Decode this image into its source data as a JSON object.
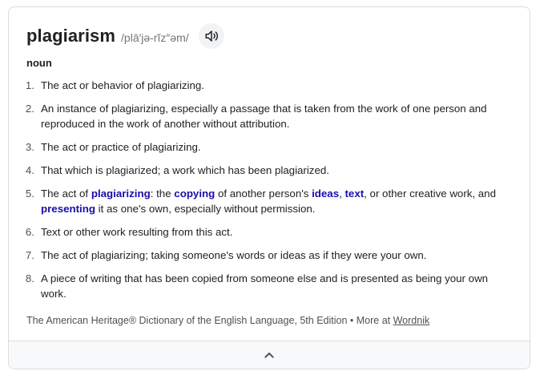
{
  "entry": {
    "word": "plagiarism",
    "pronunciation": "/plā′jə-rĭz″əm/",
    "audio_icon": "speaker-icon",
    "part_of_speech": "noun"
  },
  "definitions": [
    {
      "num": "1.",
      "text": "The act or behavior of plagiarizing."
    },
    {
      "num": "2.",
      "text": "An instance of plagiarizing, especially a passage that is taken from the work of one person and reproduced in the work of another without attribution."
    },
    {
      "num": "3.",
      "text": "The act or practice of plagiarizing."
    },
    {
      "num": "4.",
      "text": "That which is plagiarized; a work which has been plagiarized."
    },
    {
      "num": "5.",
      "parts": {
        "p1": "The act of ",
        "k1": "plagiarizing",
        "p2": ": the ",
        "k2": "copying",
        "p3": " of another person's ",
        "k3": "ideas",
        "p4": ", ",
        "k4": "text",
        "p5": ", or other creative work, and ",
        "k5": "presenting",
        "p6": " it as one's own, especially without permission."
      }
    },
    {
      "num": "6.",
      "text": "Text or other work resulting from this act."
    },
    {
      "num": "7.",
      "text": "The act of plagiarizing; taking someone's words or ideas as if they were your own."
    },
    {
      "num": "8.",
      "text": "A piece of writing that has been copied from someone else and is presented as being your own work."
    }
  ],
  "source": {
    "text": "The American Heritage® Dictionary of the English Language, 5th Edition",
    "separator": " • ",
    "more_label": "More at ",
    "link": "Wordnik"
  },
  "footer": {
    "icon": "chevron-up-icon"
  },
  "colors": {
    "link": "#1a0dab",
    "text": "#202124",
    "muted": "#70757a"
  }
}
